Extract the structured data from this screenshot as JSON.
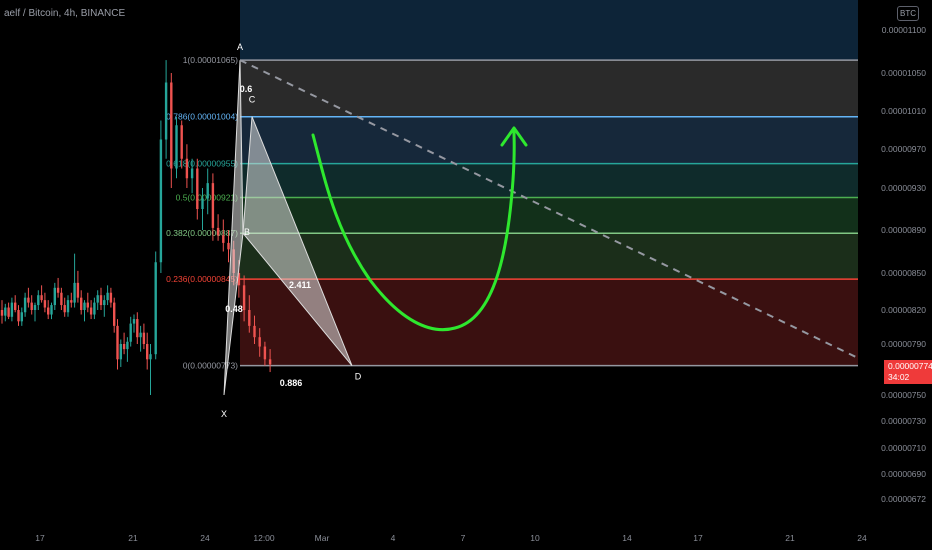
{
  "header": {
    "title": "aelf / Bitcoin, 4h, BINANCE"
  },
  "axis": {
    "currency_badge": "BTC"
  },
  "price_tag": {
    "price": "0.00000774",
    "countdown": "34:02",
    "color": "#ef3a3a"
  },
  "colors": {
    "background": "#000000",
    "up": "#26a69a",
    "down": "#ef5350",
    "arc": "#2ee82e"
  },
  "chart_data": {
    "type": "candlestick",
    "title": "aelf / Bitcoin, 4h, BINANCE",
    "y_axis": {
      "ticks": [
        "0.00001100",
        "0.00001050",
        "0.00001010",
        "0.00000970",
        "0.00000930",
        "0.00000890",
        "0.00000850",
        "0.00000820",
        "0.00000790",
        "0.00000750",
        "0.00000730",
        "0.00000710",
        "0.00000690",
        "0.00000672"
      ],
      "tick_values": [
        1.1e-05,
        1.05e-05,
        1.01e-05,
        9.7e-06,
        9.3e-06,
        8.9e-06,
        8.5e-06,
        8.2e-06,
        7.9e-06,
        7.5e-06,
        7.3e-06,
        7.1e-06,
        6.9e-06,
        6.72e-06
      ]
    },
    "x_axis": {
      "ticks": [
        "17",
        "21",
        "24",
        "12:00",
        "Mar",
        "4",
        "7",
        "10",
        "14",
        "17",
        "21",
        "24"
      ]
    },
    "fib_levels": [
      {
        "ratio": 1.0,
        "label": "1(0.00001065)",
        "price": 1.065e-05,
        "color": "#9598a1",
        "fill": "#2a2a2a"
      },
      {
        "ratio": 0.786,
        "label": "0.786(0.00001004)",
        "price": 1.004e-05,
        "color": "#64b5f6",
        "fill": "#16283a"
      },
      {
        "ratio": 0.618,
        "label": "0.618(0.00000955)",
        "price": 9.55e-06,
        "color": "#26a69a",
        "fill": "#0f2b2b"
      },
      {
        "ratio": 0.5,
        "label": "0.5(0.00000921)",
        "price": 9.21e-06,
        "color": "#4caf50",
        "fill": "#12301a"
      },
      {
        "ratio": 0.382,
        "label": "0.382(0.00000887)",
        "price": 8.87e-06,
        "color": "#81c784",
        "fill": "#1b2e1a"
      },
      {
        "ratio": 0.236,
        "label": "0.236(0.00000845)",
        "price": 8.45e-06,
        "color": "#f44336",
        "fill": "#3a1010"
      },
      {
        "ratio": 0.0,
        "label": "0(0.00000773)",
        "price": 7.73e-06,
        "color": "#9598a1",
        "fill": ""
      }
    ],
    "pattern_points": [
      {
        "label": "X",
        "price": 7.5e-06
      },
      {
        "label": "A",
        "price": 1.065e-05
      },
      {
        "label": "B",
        "price": 8.87e-06
      },
      {
        "label": "C",
        "price": 1.004e-05
      },
      {
        "label": "D",
        "price": 7.73e-06
      }
    ],
    "pattern_ratios": [
      "0.6",
      "0.48",
      "2.411",
      "0.886"
    ],
    "candles": [
      [
        820,
        828,
        808,
        815
      ],
      [
        815,
        825,
        810,
        822
      ],
      [
        822,
        826,
        812,
        814
      ],
      [
        814,
        830,
        810,
        826
      ],
      [
        826,
        832,
        818,
        820
      ],
      [
        820,
        824,
        806,
        810
      ],
      [
        810,
        822,
        806,
        818
      ],
      [
        818,
        834,
        814,
        830
      ],
      [
        830,
        838,
        822,
        826
      ],
      [
        826,
        832,
        816,
        820
      ],
      [
        820,
        826,
        810,
        824
      ],
      [
        824,
        836,
        820,
        832
      ],
      [
        832,
        840,
        826,
        828
      ],
      [
        828,
        834,
        818,
        822
      ],
      [
        822,
        828,
        812,
        816
      ],
      [
        816,
        826,
        812,
        824
      ],
      [
        824,
        842,
        820,
        838
      ],
      [
        838,
        846,
        830,
        834
      ],
      [
        834,
        838,
        820,
        824
      ],
      [
        824,
        830,
        814,
        818
      ],
      [
        818,
        832,
        814,
        828
      ],
      [
        828,
        834,
        822,
        826
      ],
      [
        826,
        868,
        822,
        842
      ],
      [
        842,
        852,
        826,
        830
      ],
      [
        830,
        836,
        816,
        820
      ],
      [
        820,
        828,
        810,
        826
      ],
      [
        826,
        834,
        818,
        822
      ],
      [
        822,
        828,
        812,
        816
      ],
      [
        816,
        830,
        812,
        826
      ],
      [
        826,
        836,
        820,
        832
      ],
      [
        832,
        838,
        820,
        824
      ],
      [
        824,
        832,
        814,
        828
      ],
      [
        828,
        840,
        824,
        834
      ],
      [
        834,
        838,
        822,
        826
      ],
      [
        826,
        830,
        800,
        806
      ],
      [
        806,
        812,
        770,
        778
      ],
      [
        778,
        794,
        772,
        790
      ],
      [
        790,
        800,
        782,
        786
      ],
      [
        786,
        796,
        776,
        792
      ],
      [
        792,
        814,
        788,
        808
      ],
      [
        808,
        816,
        800,
        812
      ],
      [
        812,
        818,
        790,
        796
      ],
      [
        796,
        806,
        784,
        800
      ],
      [
        800,
        808,
        786,
        790
      ],
      [
        790,
        800,
        770,
        778
      ],
      [
        778,
        790,
        750,
        782
      ],
      [
        782,
        870,
        778,
        860
      ],
      [
        860,
        1000,
        850,
        980
      ],
      [
        980,
        1065,
        960,
        1040
      ],
      [
        1040,
        1050,
        930,
        950
      ],
      [
        950,
        1004,
        940,
        995
      ],
      [
        995,
        1000,
        950,
        960
      ],
      [
        960,
        975,
        930,
        940
      ],
      [
        940,
        960,
        925,
        950
      ],
      [
        950,
        960,
        900,
        910
      ],
      [
        910,
        930,
        890,
        920
      ],
      [
        920,
        950,
        905,
        935
      ],
      [
        935,
        945,
        880,
        892
      ],
      [
        892,
        905,
        880,
        885
      ],
      [
        885,
        900,
        870,
        878
      ],
      [
        878,
        890,
        860,
        872
      ],
      [
        872,
        880,
        840,
        850
      ],
      [
        850,
        862,
        830,
        840
      ],
      [
        840,
        848,
        810,
        820
      ],
      [
        820,
        832,
        800,
        806
      ],
      [
        806,
        815,
        790,
        796
      ],
      [
        796,
        804,
        780,
        788
      ],
      [
        788,
        792,
        773,
        778
      ],
      [
        778,
        786,
        768,
        774
      ]
    ]
  }
}
